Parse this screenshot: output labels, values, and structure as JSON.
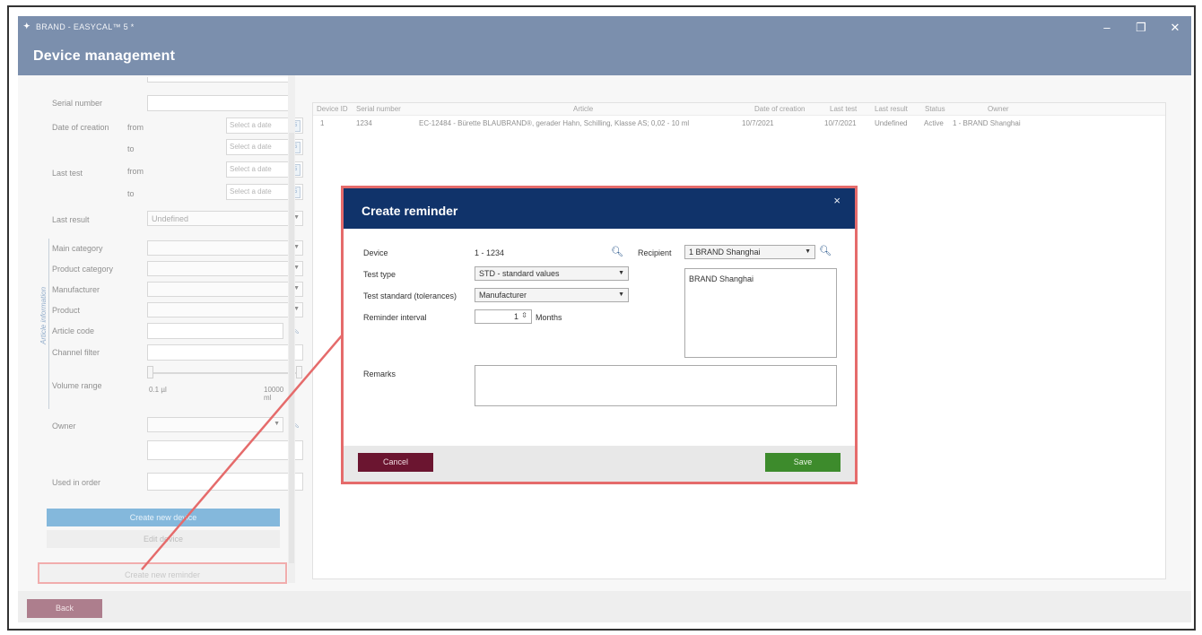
{
  "window": {
    "title": "BRAND - EASYCAL™ 5 *",
    "minimize": "–",
    "restore": "❐",
    "close": "✕"
  },
  "header": {
    "title": "Device management"
  },
  "filters": {
    "serial_number": "Serial number",
    "date_of_creation": "Date of creation",
    "from": "from",
    "to": "to",
    "select_date": "Select a date",
    "last_test": "Last test",
    "last_result": "Last result",
    "last_result_value": "Undefined",
    "article_information": "Article information",
    "main_category": "Main category",
    "product_category": "Product category",
    "manufacturer": "Manufacturer",
    "product": "Product",
    "article_code": "Article code",
    "channel_filter": "Channel filter",
    "volume_range": "Volume range",
    "volume_min": "0.1 µl",
    "volume_max": "10000 ml",
    "owner": "Owner",
    "used_in_order": "Used in order",
    "create_new_device": "Create new device",
    "edit_device": "Edit device",
    "create_new_reminder": "Create new reminder"
  },
  "grid": {
    "columns": [
      "Device ID",
      "Serial number",
      "Article",
      "Date of creation",
      "Last test",
      "Last result",
      "Status",
      "Owner"
    ],
    "rows": [
      {
        "device_id": "1",
        "serial": "1234",
        "article": "EC-12484 - Bürette BLAUBRAND®, gerader Hahn, Schilling, Klasse AS; 0,02 - 10 ml",
        "date_of_creation": "10/7/2021",
        "last_test": "10/7/2021",
        "last_result": "Undefined",
        "status": "Active",
        "owner": "1 - BRAND Shanghai"
      }
    ]
  },
  "footer": {
    "back": "Back"
  },
  "dialog": {
    "title": "Create reminder",
    "close": "×",
    "device_label": "Device",
    "device_value": "1 - 1234",
    "recipient_label": "Recipient",
    "recipient_value": "1 BRAND Shanghai",
    "recipient_box": "BRAND Shanghai",
    "test_type_label": "Test type",
    "test_type_value": "STD - standard values",
    "test_standard_label": "Test standard (tolerances)",
    "test_standard_value": "Manufacturer",
    "reminder_interval_label": "Reminder interval",
    "reminder_interval_value": "1",
    "reminder_interval_unit": "Months",
    "remarks_label": "Remarks",
    "cancel": "Cancel",
    "save": "Save"
  },
  "colors": {
    "titlebar": "#10336a",
    "blue_button": "#1f7fc0",
    "back_button": "#6b1530",
    "save_button": "#3d8b2c",
    "highlight": "#e56b6b"
  }
}
